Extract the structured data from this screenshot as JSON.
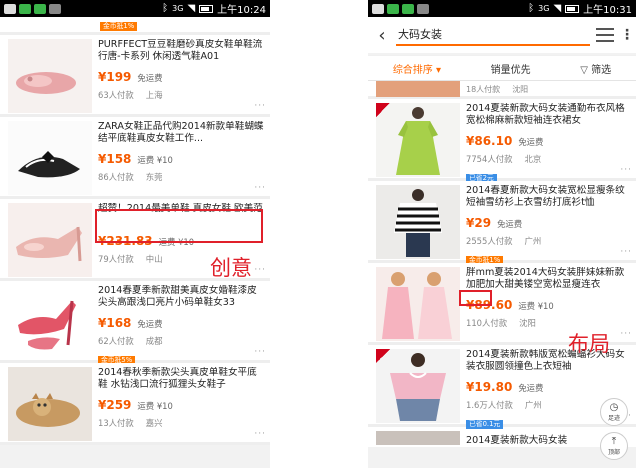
{
  "status_bar": {
    "signal_text": "3G",
    "left_time": "上午10:24",
    "right_time": "上午10:31"
  },
  "left_list": {
    "items": [
      {
        "title": "PURFFECT豆豆鞋磨砂真皮女鞋单鞋流行唐-卡系列 休闲透气鞋A01",
        "price": "¥199",
        "shipping": "免运费",
        "sold": "63人付款",
        "location": "上海",
        "promo": ""
      },
      {
        "title": "ZARA女鞋正品代购2014新款单鞋蝴蝶结平底鞋真皮女鞋工作...",
        "price": "¥158",
        "shipping": "运费 ¥10",
        "sold": "86人付款",
        "location": "东莞",
        "promo": ""
      },
      {
        "title": "超赞！2014最美单鞋 真皮女鞋 欧美范",
        "price": "¥231.83",
        "shipping": "运费 ¥10",
        "sold": "79人付款",
        "location": "中山",
        "promo": ""
      },
      {
        "title": "2014春夏季新款甜美真皮女婚鞋漆皮尖头高跟浅口亮片小码单鞋女33",
        "price": "¥168",
        "shipping": "免运费",
        "sold": "62人付款",
        "location": "成都",
        "promo": "金币抵5%"
      },
      {
        "title": "2014春秋季新款尖头真皮单鞋女平底鞋 水钻浅口流行狐狸头女鞋子",
        "price": "¥259",
        "shipping": "运费 ¥10",
        "sold": "13人付款",
        "location": "嘉兴",
        "promo": ""
      }
    ],
    "top_promo": "金币抵1%"
  },
  "right_header": {
    "back_icon": "chevron-left-icon",
    "search_value": "大码女装",
    "sort_options": [
      "综合排序",
      "销量优先",
      "筛选"
    ]
  },
  "right_list": {
    "partial_top": {
      "sold": "18人付款",
      "location": "沈阳"
    },
    "items": [
      {
        "title": "2014夏装新款大码女装通勤布衣风格宽松棉麻新款短袖连衣裙女",
        "price": "¥86.10",
        "shipping": "免运费",
        "sold": "7754人付款",
        "location": "北京",
        "promo": "已省2元",
        "promo_color": "blue"
      },
      {
        "title": "2014春夏新款大码女装宽松显瘦条纹短袖雪纺衫上衣雪纺打底衫t恤",
        "price": "¥29",
        "shipping": "免运费",
        "sold": "2555人付款",
        "location": "广州",
        "promo": "金币抵1%",
        "promo_color": "orange"
      },
      {
        "title": "胖mm夏装2014大码女装胖妹妹新款加肥加大甜美镂空宽松显瘦连衣",
        "price": "¥89.60",
        "shipping": "运费 ¥10",
        "sold": "110人付款",
        "location": "沈阳",
        "promo": "",
        "promo_color": ""
      },
      {
        "title": "2014夏装新款韩版宽松蝙蝠衫大码女装衣服圆领撞色上衣短袖",
        "price": "¥19.80",
        "shipping": "免运费",
        "sold": "1.6万人付款",
        "location": "广州",
        "promo": "已省0.1元",
        "promo_color": "blue"
      }
    ],
    "partial_bottom": "2014夏装新款大码女装"
  },
  "floating": {
    "footprint_label": "足迹",
    "top_label": "顶部"
  },
  "annotations": {
    "creative_label": "创意",
    "layout_label": "布局"
  },
  "colors": {
    "accent": "#ff6a00",
    "price": "#f55a00",
    "annotation_red": "#e0202a"
  }
}
